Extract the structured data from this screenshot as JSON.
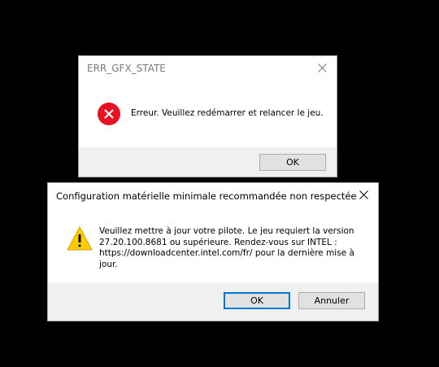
{
  "dialog_error": {
    "title": "ERR_GFX_STATE",
    "icon": "error-icon",
    "message": "Erreur. Veuillez redémarrer et relancer le jeu.",
    "ok_label": "OK"
  },
  "dialog_warning": {
    "title": "Configuration matérielle minimale recommandée non respectée",
    "icon": "warning-icon",
    "message_lines": [
      "Veuillez mettre à jour votre pilote. Le jeu requiert la version",
      "27.20.100.8681 ou supérieure. Rendez-vous sur INTEL :",
      "https://downloadcenter.intel.com/fr/ pour la dernière mise à",
      "jour."
    ],
    "ok_label": "OK",
    "cancel_label": "Annuler"
  },
  "colors": {
    "background": "#000000",
    "error_red": "#e81123",
    "warning_yellow": "#ffcc00",
    "default_button_border": "#0078d7"
  }
}
